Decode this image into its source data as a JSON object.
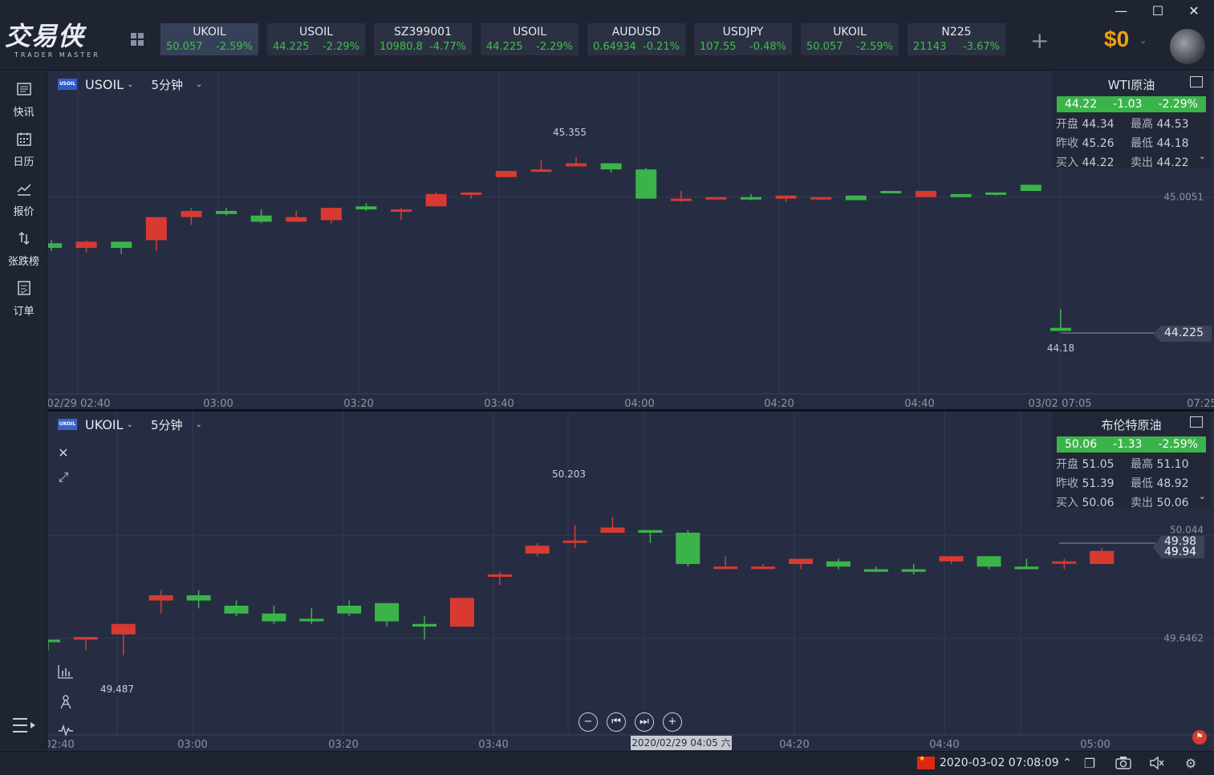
{
  "app": {
    "logo_main": "交易侠",
    "logo_sub": "TRADER MASTER",
    "balance": "$0"
  },
  "window": {
    "minimize": "—",
    "maximize": "☐",
    "close": "✕"
  },
  "tickers": [
    {
      "symbol": "UKOIL",
      "price": "50.057",
      "change": "-2.59%"
    },
    {
      "symbol": "USOIL",
      "price": "44.225",
      "change": "-2.29%"
    },
    {
      "symbol": "SZ399001",
      "price": "10980.8",
      "change": "-4.77%"
    },
    {
      "symbol": "USOIL",
      "price": "44.225",
      "change": "-2.29%"
    },
    {
      "symbol": "AUDUSD",
      "price": "0.64934",
      "change": "-0.21%"
    },
    {
      "symbol": "USDJPY",
      "price": "107.55",
      "change": "-0.48%"
    },
    {
      "symbol": "UKOIL",
      "price": "50.057",
      "change": "-2.59%"
    },
    {
      "symbol": "N225",
      "price": "21143",
      "change": "-3.67%"
    }
  ],
  "sidebar": {
    "items": [
      {
        "label": "快讯",
        "icon": "news-icon"
      },
      {
        "label": "日历",
        "icon": "calendar-icon"
      },
      {
        "label": "报价",
        "icon": "quote-chart-icon"
      },
      {
        "label": "张跌榜",
        "icon": "updown-icon"
      },
      {
        "label": "订单",
        "icon": "order-icon"
      }
    ]
  },
  "colors": {
    "up": "#3ab44a",
    "down": "#d83a32",
    "bg": "#262d42",
    "accent": "#f0a010"
  },
  "chart_top": {
    "badge": "USOIL",
    "symbol": "USOIL",
    "period": "5分钟",
    "quote": {
      "title": "WTI原油",
      "last": "44.22",
      "chg": "-1.03",
      "pct": "-2.29%",
      "open_label": "开盘",
      "open": "44.34",
      "high_label": "最高",
      "high": "44.53",
      "prev_label": "昨收",
      "prev": "45.26",
      "low_label": "最低",
      "low": "44.18",
      "bid_label": "买入",
      "bid": "44.22",
      "ask_label": "卖出",
      "ask": "44.22"
    },
    "price_tag": "44.225",
    "high_label": "45.355",
    "low_label": "44.18",
    "y_label_1": "45.0051",
    "x_labels": [
      "02/29 02:40",
      "03:00",
      "03:20",
      "03:40",
      "04:00",
      "04:20",
      "04:40",
      "03/02 07:05",
      "07:25"
    ]
  },
  "chart_bottom": {
    "badge": "UKOIL",
    "symbol": "UKOIL",
    "period": "5分钟",
    "quote": {
      "title": "布伦特原油",
      "last": "50.06",
      "chg": "-1.33",
      "pct": "-2.59%",
      "open_label": "开盘",
      "open": "51.05",
      "high_label": "最高",
      "high": "51.10",
      "prev_label": "昨收",
      "prev": "51.39",
      "low_label": "最低",
      "low": "48.92",
      "bid_label": "买入",
      "bid": "50.06",
      "ask_label": "卖出",
      "ask": "50.06"
    },
    "price_tag_1": "49.98",
    "price_tag_2": "49.94",
    "high_label": "50.203",
    "low_label": "49.487",
    "y_label_1": "50.044",
    "y_label_2": "49.6462",
    "x_labels": [
      "02:40",
      "03:00",
      "03:20",
      "03:40",
      "04:20",
      "04:40",
      "05:00"
    ],
    "crosshair_label": "2020/02/29 04:05 六"
  },
  "status": {
    "datetime": "2020-03-02 07:08:09"
  },
  "chart_data": [
    {
      "type": "candlestick",
      "title": "WTI原油",
      "series_name": "USOIL",
      "ylim": [
        44.12,
        45.45
      ],
      "candles": [
        {
          "o": 44.75,
          "c": 44.72,
          "h": 44.77,
          "l": 44.7
        },
        {
          "o": 44.72,
          "c": 44.76,
          "h": 44.77,
          "l": 44.69
        },
        {
          "o": 44.76,
          "c": 44.72,
          "h": 44.76,
          "l": 44.68
        },
        {
          "o": 44.77,
          "c": 44.92,
          "h": 44.92,
          "l": 44.7
        },
        {
          "o": 44.92,
          "c": 44.96,
          "h": 44.98,
          "l": 44.87
        },
        {
          "o": 44.96,
          "c": 44.94,
          "h": 44.98,
          "l": 44.93
        },
        {
          "o": 44.93,
          "c": 44.89,
          "h": 44.97,
          "l": 44.88
        },
        {
          "o": 44.89,
          "c": 44.92,
          "h": 44.96,
          "l": 44.89
        },
        {
          "o": 44.9,
          "c": 44.98,
          "h": 44.98,
          "l": 44.88
        },
        {
          "o": 44.99,
          "c": 44.97,
          "h": 45.01,
          "l": 44.96
        },
        {
          "o": 44.97,
          "c": 44.97,
          "h": 44.98,
          "l": 44.9
        },
        {
          "o": 44.99,
          "c": 45.07,
          "h": 45.08,
          "l": 44.99
        },
        {
          "o": 45.08,
          "c": 45.08,
          "h": 45.08,
          "l": 45.04
        },
        {
          "o": 45.18,
          "c": 45.22,
          "h": 45.22,
          "l": 45.18
        },
        {
          "o": 45.22,
          "c": 45.23,
          "h": 45.29,
          "l": 45.22
        },
        {
          "o": 45.25,
          "c": 45.27,
          "h": 45.31,
          "l": 45.25
        },
        {
          "o": 45.27,
          "c": 45.23,
          "h": 45.27,
          "l": 45.21
        },
        {
          "o": 45.23,
          "c": 45.04,
          "h": 45.24,
          "l": 45.04
        },
        {
          "o": 45.04,
          "c": 45.04,
          "h": 45.09,
          "l": 45.02
        },
        {
          "o": 45.04,
          "c": 45.05,
          "h": 45.05,
          "l": 45.04
        },
        {
          "o": 45.05,
          "c": 45.04,
          "h": 45.07,
          "l": 45.03
        },
        {
          "o": 45.04,
          "c": 45.06,
          "h": 45.06,
          "l": 45.02
        },
        {
          "o": 45.04,
          "c": 45.05,
          "h": 45.05,
          "l": 45.03
        },
        {
          "o": 45.06,
          "c": 45.03,
          "h": 45.06,
          "l": 45.03
        },
        {
          "o": 45.09,
          "c": 45.08,
          "h": 45.09,
          "l": 45.08
        },
        {
          "o": 45.05,
          "c": 45.09,
          "h": 45.09,
          "l": 45.05
        },
        {
          "o": 45.07,
          "c": 45.05,
          "h": 45.07,
          "l": 45.05
        },
        {
          "o": 45.08,
          "c": 45.07,
          "h": 45.08,
          "l": 45.06
        },
        {
          "o": 45.13,
          "c": 45.09,
          "h": 45.13,
          "l": 45.09
        }
      ],
      "last_candle": {
        "o": 44.18,
        "c": 44.2,
        "h": 44.32,
        "l": 44.18
      }
    },
    {
      "type": "candlestick",
      "title": "布伦特原油",
      "series_name": "UKOIL",
      "ylim": [
        49.45,
        50.25
      ],
      "candles": [
        {
          "o": 49.64,
          "c": 49.63,
          "h": 49.64,
          "l": 49.6
        },
        {
          "o": 49.64,
          "c": 49.65,
          "h": 49.65,
          "l": 49.6
        },
        {
          "o": 49.66,
          "c": 49.7,
          "h": 49.7,
          "l": 49.58
        },
        {
          "o": 49.79,
          "c": 49.81,
          "h": 49.83,
          "l": 49.74
        },
        {
          "o": 49.81,
          "c": 49.79,
          "h": 49.83,
          "l": 49.76
        },
        {
          "o": 49.77,
          "c": 49.74,
          "h": 49.79,
          "l": 49.73
        },
        {
          "o": 49.74,
          "c": 49.71,
          "h": 49.77,
          "l": 49.7
        },
        {
          "o": 49.72,
          "c": 49.71,
          "h": 49.76,
          "l": 49.7
        },
        {
          "o": 49.77,
          "c": 49.74,
          "h": 49.79,
          "l": 49.73
        },
        {
          "o": 49.78,
          "c": 49.71,
          "h": 49.78,
          "l": 49.69
        },
        {
          "o": 49.7,
          "c": 49.69,
          "h": 49.73,
          "l": 49.64
        },
        {
          "o": 49.69,
          "c": 49.8,
          "h": 49.8,
          "l": 49.69
        },
        {
          "o": 49.89,
          "c": 49.89,
          "h": 49.9,
          "l": 49.85
        },
        {
          "o": 49.97,
          "c": 50.0,
          "h": 50.01,
          "l": 49.96
        },
        {
          "o": 50.02,
          "c": 50.02,
          "h": 50.08,
          "l": 49.99
        },
        {
          "o": 50.05,
          "c": 50.07,
          "h": 50.11,
          "l": 50.05
        },
        {
          "o": 50.06,
          "c": 50.05,
          "h": 50.06,
          "l": 50.01
        },
        {
          "o": 50.05,
          "c": 49.93,
          "h": 50.06,
          "l": 49.92
        },
        {
          "o": 49.92,
          "c": 49.92,
          "h": 49.96,
          "l": 49.91
        },
        {
          "o": 49.92,
          "c": 49.92,
          "h": 49.93,
          "l": 49.91
        },
        {
          "o": 49.93,
          "c": 49.95,
          "h": 49.95,
          "l": 49.91
        },
        {
          "o": 49.94,
          "c": 49.92,
          "h": 49.95,
          "l": 49.91
        },
        {
          "o": 49.91,
          "c": 49.9,
          "h": 49.92,
          "l": 49.9
        },
        {
          "o": 49.91,
          "c": 49.9,
          "h": 49.93,
          "l": 49.89
        },
        {
          "o": 49.94,
          "c": 49.96,
          "h": 49.96,
          "l": 49.93
        },
        {
          "o": 49.96,
          "c": 49.92,
          "h": 49.96,
          "l": 49.91
        },
        {
          "o": 49.92,
          "c": 49.91,
          "h": 49.95,
          "l": 49.91
        },
        {
          "o": 49.94,
          "c": 49.94,
          "h": 49.95,
          "l": 49.91
        },
        {
          "o": 49.93,
          "c": 49.98,
          "h": 49.99,
          "l": 49.93
        }
      ]
    }
  ]
}
